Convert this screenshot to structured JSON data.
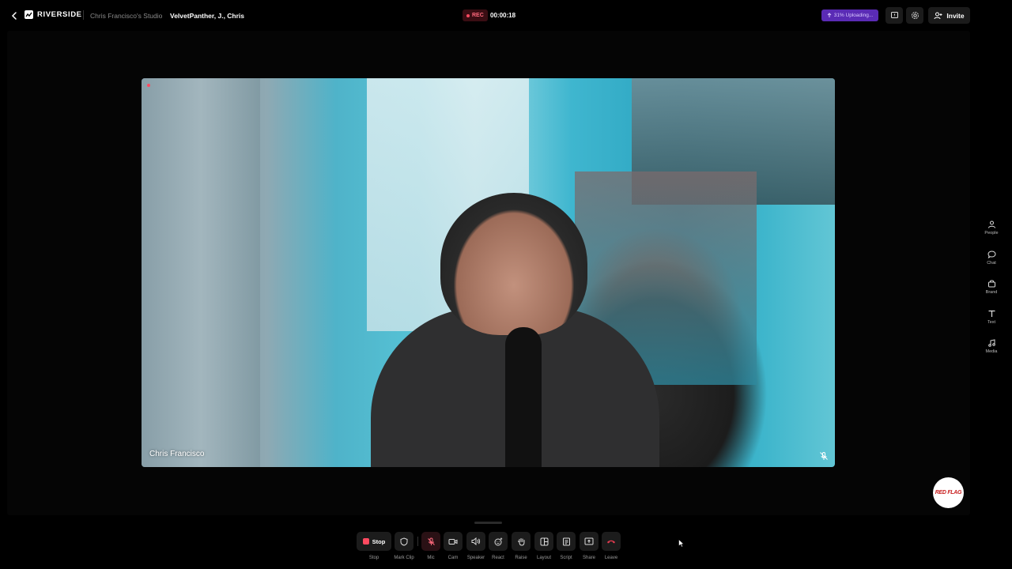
{
  "header": {
    "brand": "RIVERSIDE",
    "studio": "Chris Francisco's Studio",
    "session": "VelvetPanther, J., Chris",
    "rec_label": "REC",
    "timer": "00:00:18",
    "upload_status": "31% Uploading...",
    "invite_label": "Invite",
    "icons": [
      "back-arrow",
      "riverside-logo",
      "upload-arrow",
      "feedback",
      "settings-gear",
      "add-person"
    ]
  },
  "video": {
    "participant_name": "Chris Francisco",
    "mic_muted_icon": "mic-off"
  },
  "sidebar": {
    "items": [
      {
        "label": "People",
        "icon": "people"
      },
      {
        "label": "Chat",
        "icon": "chat-bubble"
      },
      {
        "label": "Brand",
        "icon": "brand-bag"
      },
      {
        "label": "Text",
        "icon": "text-T"
      },
      {
        "label": "Media",
        "icon": "music-note"
      }
    ]
  },
  "brand_badge": {
    "text": "RED FLAG"
  },
  "controls": {
    "stop_button": "Stop",
    "items": [
      {
        "label": "Stop"
      },
      {
        "label": "Mark Clip"
      },
      {
        "label": "Mic"
      },
      {
        "label": "Cam"
      },
      {
        "label": "Speaker"
      },
      {
        "label": "React"
      },
      {
        "label": "Raise"
      },
      {
        "label": "Layout"
      },
      {
        "label": "Script"
      },
      {
        "label": "Share"
      },
      {
        "label": "Leave"
      }
    ]
  },
  "colors": {
    "rec_red": "#ff4a60",
    "upload_purple": "#5a2bb5",
    "leave_red": "#e03a4e"
  }
}
